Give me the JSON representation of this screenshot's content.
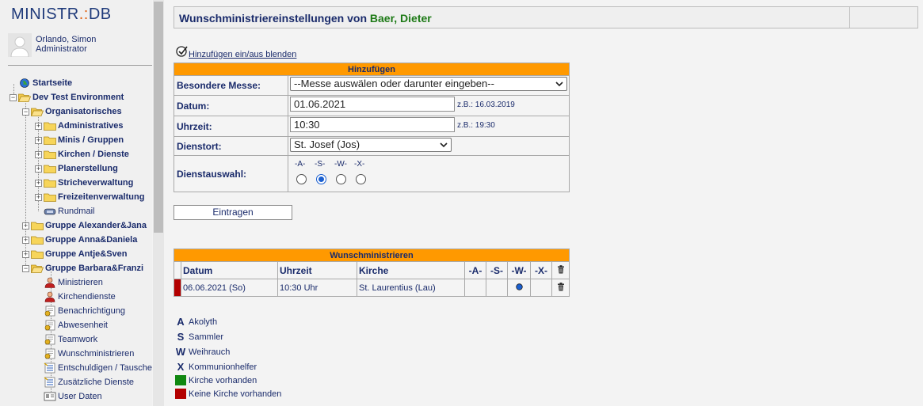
{
  "app": {
    "logo_main": "MINISTR",
    "logo_dot": ".:",
    "logo_end": "DB"
  },
  "user": {
    "name": "Orlando, Simon",
    "role": "Administrator"
  },
  "tree": [
    {
      "label": "Startseite",
      "icon": "globe-icon"
    },
    {
      "label": "Dev Test Environment",
      "icon": "folder-open-icon"
    },
    {
      "label": "Organisatorisches",
      "icon": "folder-open-icon"
    },
    {
      "label": "Administratives",
      "icon": "folder-icon"
    },
    {
      "label": "Minis / Gruppen",
      "icon": "folder-icon"
    },
    {
      "label": "Kirchen / Dienste",
      "icon": "folder-icon"
    },
    {
      "label": "Planerstellung",
      "icon": "folder-icon"
    },
    {
      "label": "Stricheverwaltung",
      "icon": "folder-icon"
    },
    {
      "label": "Freizeitenverwaltung",
      "icon": "folder-icon"
    },
    {
      "label": "Rundmail",
      "icon": "mail-icon"
    },
    {
      "label": "Gruppe Alexander&Jana",
      "icon": "folder-icon"
    },
    {
      "label": "Gruppe Anna&Daniela",
      "icon": "folder-icon"
    },
    {
      "label": "Gruppe Antje&Sven",
      "icon": "folder-icon"
    },
    {
      "label": "Gruppe Barbara&Franzi",
      "icon": "folder-open-icon"
    },
    {
      "label": "Ministrieren",
      "icon": "person-icon"
    },
    {
      "label": "Kirchendienste",
      "icon": "person-icon"
    },
    {
      "label": "Benachrichtigung",
      "icon": "settings-doc-icon"
    },
    {
      "label": "Abwesenheit",
      "icon": "settings-doc-icon"
    },
    {
      "label": "Teamwork",
      "icon": "settings-doc-icon"
    },
    {
      "label": "Wunschministrieren",
      "icon": "settings-doc-icon"
    },
    {
      "label": "Entschuldigen / Tauschen",
      "icon": "list-icon"
    },
    {
      "label": "Zusätzliche Dienste",
      "icon": "list-icon"
    },
    {
      "label": "User Daten",
      "icon": "id-card-icon"
    }
  ],
  "header": {
    "title_prefix": "Wunschministriereinstellungen von ",
    "title_name": "Baer, Dieter"
  },
  "toggle_link": "Hinzufügen ein/aus blenden",
  "form": {
    "title": "Hinzufügen",
    "messe_label": "Besondere Messe:",
    "messe_value": "--Messe auswälen oder darunter eingeben--",
    "datum_label": "Datum:",
    "datum_value": "01.06.2021",
    "datum_hint": "z.B.: 16.03.2019",
    "uhrzeit_label": "Uhrzeit:",
    "uhrzeit_value": "10:30",
    "uhrzeit_hint": "z.B.: 19:30",
    "dienstort_label": "Dienstort:",
    "dienstort_value": "St. Josef (Jos)",
    "dienstauswahl_label": "Dienstauswahl:",
    "dienst_options": [
      "-A-",
      "-S-",
      "-W-",
      "-X-"
    ],
    "dienst_selected": "-S-",
    "submit_label": "Eintragen"
  },
  "list": {
    "title": "Wunschministrieren",
    "columns": [
      "Datum",
      "Uhrzeit",
      "Kirche",
      "-A-",
      "-S-",
      "-W-",
      "-X-"
    ],
    "rows": [
      {
        "status_color": "#b30000",
        "datum": "06.06.2021 (So)",
        "uhrzeit": "10:30 Uhr",
        "kirche": "St. Laurentius (Lau)",
        "selected": "-W-"
      }
    ]
  },
  "legend": [
    {
      "key": "A",
      "text": "Akolyth"
    },
    {
      "key": "S",
      "text": "Sammler"
    },
    {
      "key": "W",
      "text": "Weihrauch"
    },
    {
      "key": "X",
      "text": "Kommunionhelfer"
    },
    {
      "swatch": "#118811",
      "text": "Kirche vorhanden"
    },
    {
      "swatch": "#b30000",
      "text": "Keine Kirche vorhanden"
    }
  ],
  "colors": {
    "accent_orange": "#ff9900",
    "text_navy": "#1a2b6b",
    "name_green": "#1d7a16"
  }
}
